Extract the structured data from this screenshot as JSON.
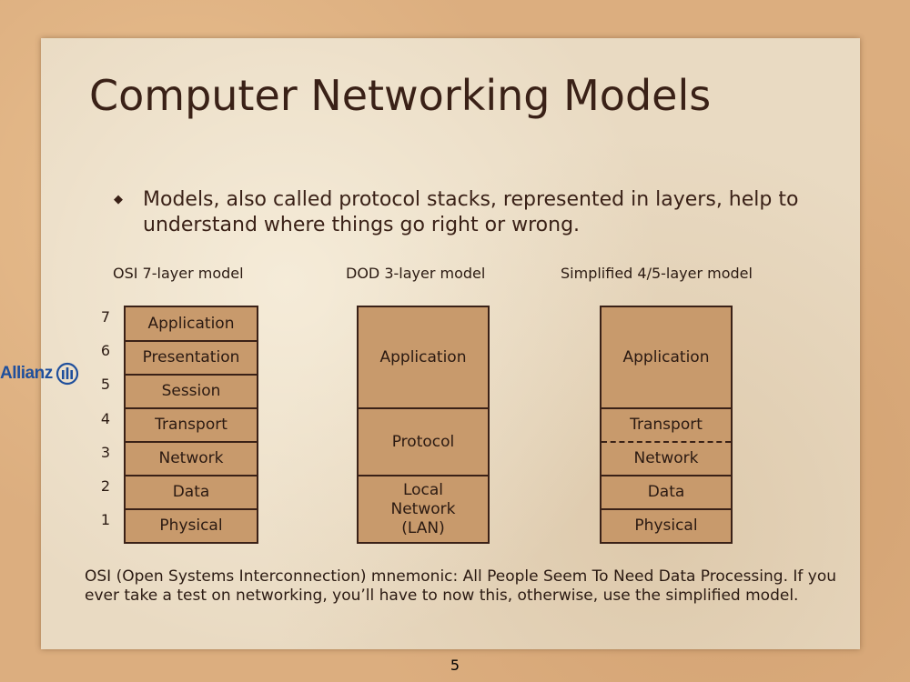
{
  "slide": {
    "title": "Computer Networking Models",
    "bullet": "Models, also called protocol stacks, represented in layers, help to understand where things go right or wrong.",
    "bullet_icon": "diamond-bullet-icon",
    "models": {
      "osi": {
        "title": "OSI 7-layer model",
        "layers": [
          {
            "number": "7",
            "name": "Application"
          },
          {
            "number": "6",
            "name": "Presentation"
          },
          {
            "number": "5",
            "name": "Session"
          },
          {
            "number": "4",
            "name": "Transport"
          },
          {
            "number": "3",
            "name": "Network"
          },
          {
            "number": "2",
            "name": "Data"
          },
          {
            "number": "1",
            "name": "Physical"
          }
        ]
      },
      "dod": {
        "title": "DOD 3-layer model",
        "layers": [
          "Application",
          "Protocol",
          "Local Network (LAN)"
        ]
      },
      "simplified": {
        "title": "Simplified 4/5-layer model",
        "layers": [
          "Application",
          "Transport",
          "Network",
          "Data",
          "Physical"
        ]
      }
    },
    "footer": "OSI (Open Systems Interconnection) mnemonic: All People Seem To Need Data Processing. If you ever take a test on networking, you’ll have to now this, otherwise, use the simplified model.",
    "page_number": "5",
    "logo": {
      "text": "Allianz",
      "icon": "allianz-eagle-icon",
      "color": "#1f4f9c"
    }
  },
  "colors": {
    "background": "#dcae7f",
    "paper": "#e9dac2",
    "layer_fill": "#c89a6c",
    "layer_border": "#3a2117"
  }
}
